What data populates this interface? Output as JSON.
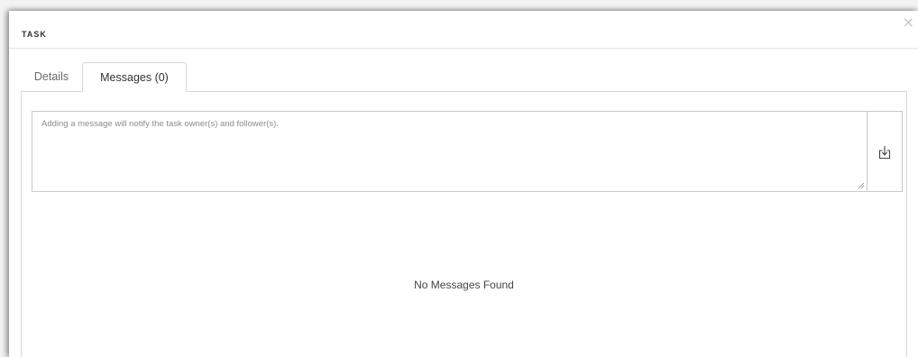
{
  "modal": {
    "title": "TASK",
    "close_glyph": "×"
  },
  "tabs": [
    {
      "label": "Details",
      "active": false
    },
    {
      "label": "Messages (0)",
      "active": true
    }
  ],
  "message_input": {
    "placeholder": "Adding a message will notify the task owner(s) and follower(s).",
    "value": ""
  },
  "send_button": {
    "icon": "download-tray-icon"
  },
  "messages": {
    "empty_text": "No Messages Found"
  },
  "colors": {
    "border": "#d6d6d6",
    "text": "#333333",
    "muted": "#8c8c8c"
  }
}
